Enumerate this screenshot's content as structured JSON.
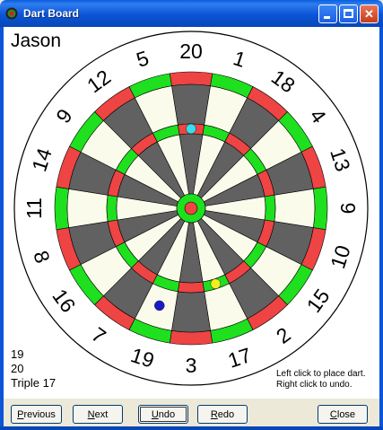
{
  "window": {
    "title": "Dart Board"
  },
  "player": {
    "name": "Jason"
  },
  "board": {
    "numbers": [
      "20",
      "1",
      "18",
      "4",
      "13",
      "6",
      "10",
      "15",
      "2",
      "17",
      "3",
      "19",
      "7",
      "16",
      "8",
      "11",
      "14",
      "9",
      "12",
      "5"
    ],
    "colors": {
      "black": "#616161",
      "white": "#fbfbeb",
      "red": "#ef4444",
      "green": "#1ee01e",
      "rim": "#ffffff"
    }
  },
  "darts": [
    {
      "color": "#33e0f0",
      "segment": "20",
      "ring": "triple"
    },
    {
      "color": "#f2ee22",
      "segment": "17",
      "ring": "triple"
    },
    {
      "color": "#1a1ac8",
      "segment": "19",
      "ring": "single"
    }
  ],
  "throws": [
    "19",
    "20",
    "Triple 17"
  ],
  "instructions": {
    "line1": "Left click to place dart.",
    "line2": "Right click to undo."
  },
  "buttons": {
    "previous": "Previous",
    "next": "Next",
    "undo": "Undo",
    "redo": "Redo",
    "close": "Close"
  }
}
